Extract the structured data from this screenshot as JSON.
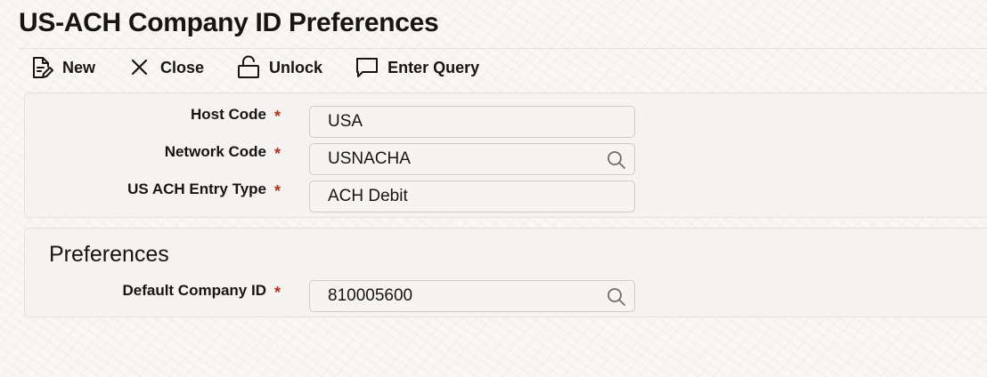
{
  "page": {
    "title": "US-ACH Company ID Preferences"
  },
  "toolbar": {
    "new_label": "New",
    "new_icon": "document-edit-icon",
    "close_label": "Close",
    "close_icon": "close-icon",
    "unlock_label": "Unlock",
    "unlock_icon": "unlock-icon",
    "enter_query_label": "Enter Query",
    "enter_query_icon": "speech-bubble-icon"
  },
  "fields": {
    "host_code": {
      "label": "Host Code",
      "required": "*",
      "value": "USA"
    },
    "network_code": {
      "label": "Network Code",
      "required": "*",
      "value": "USNACHA",
      "lookup_icon": "search-icon"
    },
    "entry_type": {
      "label": "US ACH Entry Type",
      "required": "*",
      "value": "ACH Debit"
    }
  },
  "preferences": {
    "title": "Preferences",
    "default_company_id": {
      "label": "Default Company ID",
      "required": "*",
      "value": "810005600",
      "lookup_icon": "search-icon"
    }
  },
  "colors": {
    "text": "#161513",
    "required": "#b3331c",
    "panel_bg": "#f4f3f1",
    "field_border": "#cfcbc3"
  }
}
